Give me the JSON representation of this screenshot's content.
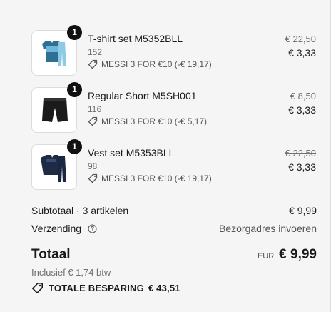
{
  "items": [
    {
      "name": "T-shirt set M5352BLL",
      "variant": "152",
      "discount": "MESSI 3 FOR €10 (-€ 19,17)",
      "quantity": "1",
      "price_original": "€ 22,50",
      "price_final": "€ 3,33",
      "image": "tshirt-set-icon"
    },
    {
      "name": "Regular Short M5SH001",
      "variant": "116",
      "discount": "MESSI 3 FOR €10 (-€ 5,17)",
      "quantity": "1",
      "price_original": "€ 8,50",
      "price_final": "€ 3,33",
      "image": "shorts-icon"
    },
    {
      "name": "Vest set M5353BLL",
      "variant": "98",
      "discount": "MESSI 3 FOR €10 (-€ 19,17)",
      "quantity": "1",
      "price_original": "€ 22,50",
      "price_final": "€ 3,33",
      "image": "vest-set-icon"
    }
  ],
  "summary": {
    "subtotal_label": "Subtotaal · 3 artikelen",
    "subtotal_value": "€ 9,99",
    "shipping_label": "Verzending",
    "shipping_value": "Bezorgadres invoeren",
    "total_label": "Totaal",
    "currency": "EUR",
    "total_value": "€ 9,99",
    "tax_note": "Inclusief € 1,74 btw",
    "savings_label": "TOTALE BESPARING",
    "savings_value": "€ 43,51"
  },
  "colors": {
    "panel_bg": "#f5f5f5",
    "badge_bg": "#111111",
    "muted_text": "#707070"
  }
}
